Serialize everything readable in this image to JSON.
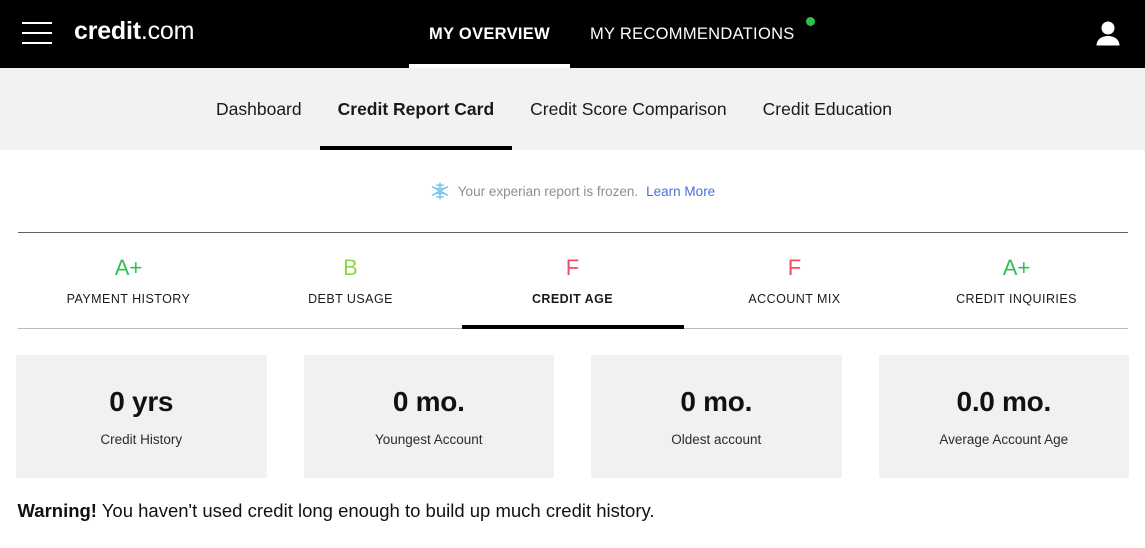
{
  "header": {
    "menu_icon": "hamburger-menu-icon",
    "logo_bold": "credit",
    "logo_light": ".com",
    "avatar_icon": "user-avatar-icon",
    "nav": [
      {
        "label": "MY OVERVIEW",
        "active": true,
        "badge": false
      },
      {
        "label": "MY RECOMMENDATIONS",
        "active": false,
        "badge": true
      }
    ],
    "badge_color": "#2fc14f"
  },
  "subnav": {
    "items": [
      {
        "label": "Dashboard",
        "active": false
      },
      {
        "label": "Credit Report Card",
        "active": true
      },
      {
        "label": "Credit Score Comparison",
        "active": false
      },
      {
        "label": "Credit Education",
        "active": false
      }
    ]
  },
  "notice": {
    "icon": "snowflake-icon",
    "icon_color": "#7fc6f2",
    "text": "Your experian report is frozen.",
    "link_label": "Learn More",
    "link_color": "#4a6fe0"
  },
  "grades": {
    "items": [
      {
        "letter": "A+",
        "label": "PAYMENT HISTORY",
        "color": "#34bf5a",
        "active": false
      },
      {
        "letter": "B",
        "label": "DEBT USAGE",
        "color": "#8bd93e",
        "active": false
      },
      {
        "letter": "F",
        "label": "CREDIT AGE",
        "color": "#ef4e63",
        "active": true
      },
      {
        "letter": "F",
        "label": "ACCOUNT MIX",
        "color": "#ef4e63",
        "active": false
      },
      {
        "letter": "A+",
        "label": "CREDIT INQUIRIES",
        "color": "#34bf5a",
        "active": false
      }
    ]
  },
  "stats": {
    "cards": [
      {
        "value": "0 yrs",
        "label": "Credit History"
      },
      {
        "value": "0 mo.",
        "label": "Youngest Account"
      },
      {
        "value": "0 mo.",
        "label": "Oldest account"
      },
      {
        "value": "0.0 mo.",
        "label": "Average Account Age"
      }
    ]
  },
  "warning": {
    "title": "Warning!",
    "body": " You haven't used credit long enough to build up much credit history."
  }
}
